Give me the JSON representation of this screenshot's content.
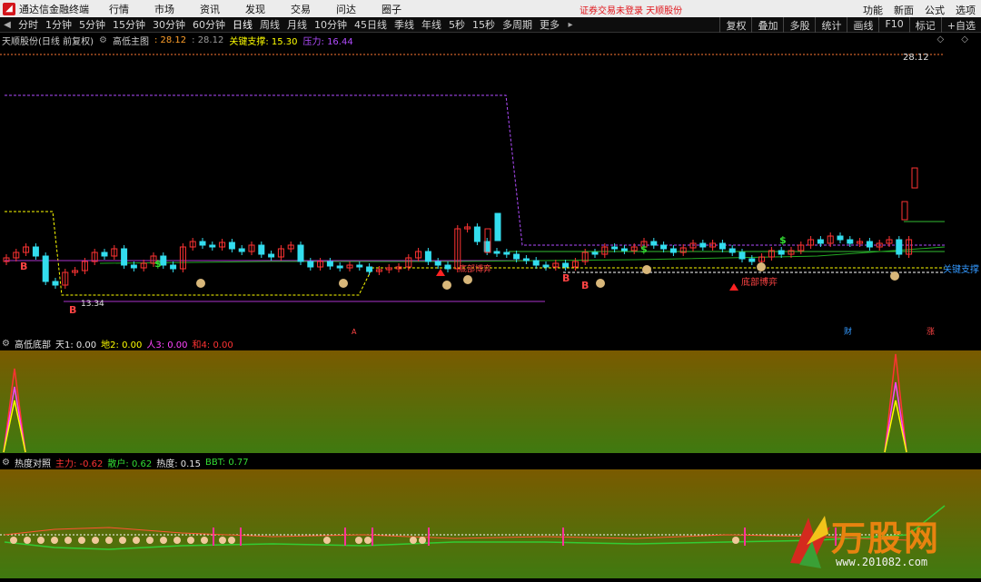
{
  "menubar": {
    "app_title": "通达信金融终端",
    "items": [
      "行情",
      "市场",
      "资讯",
      "发现",
      "交易",
      "问达",
      "圈子"
    ],
    "notice": "证券交易未登录  天顺股份",
    "right_items": [
      "功能",
      "新面",
      "公式",
      "选项"
    ]
  },
  "periodbar": {
    "periods": [
      "分时",
      "1分钟",
      "5分钟",
      "15分钟",
      "30分钟",
      "60分钟",
      "日线",
      "周线",
      "月线",
      "10分钟",
      "45日线",
      "季线",
      "年线",
      "5秒",
      "15秒",
      "多周期",
      "更多"
    ],
    "active": "日线",
    "tools": [
      "复权",
      "叠加",
      "多股",
      "统计",
      "画线",
      "F10",
      "标记",
      "+自选"
    ]
  },
  "infoline": {
    "stock": "天顺股份(日线 前复权)",
    "indicator": "高低主图",
    "value1": ": 28.12",
    "value2": ": 28.12",
    "support_label": "关键支撑: 15.30",
    "pressure_label": "压力: 16.44",
    "icons": "◇ ◇"
  },
  "main_chart": {
    "price_label_top": "28.12",
    "price_label_low": "13.34",
    "support_right_label": "关键支撑",
    "bottom_game_label": "底部博弈",
    "buy_marker": "B",
    "money_marker": "$",
    "bottom_tags": [
      "财",
      "涨"
    ],
    "tiny_marker": "A",
    "colors": {
      "up": "#ff3333",
      "down": "#33ddee",
      "support": "#ffff00",
      "pressure": "#b14cff",
      "avg": "#33bb33"
    }
  },
  "chart_data": [
    {
      "type": "candlestick",
      "title": "天顺股份(日线 前复权) 高低主图",
      "top_price": 28.12,
      "low_price": 13.34,
      "support": 15.3,
      "pressure": 16.44
    },
    {
      "type": "area",
      "title": "高低底部",
      "series": [
        {
          "name": "天1",
          "last": 0.0
        },
        {
          "name": "地2",
          "last": 0.0
        },
        {
          "name": "人3",
          "last": 0.0
        },
        {
          "name": "和4",
          "last": 0.0
        }
      ]
    },
    {
      "type": "line",
      "title": "热度对照",
      "series": [
        {
          "name": "主力",
          "last": -0.62
        },
        {
          "name": "散户",
          "last": 0.62
        },
        {
          "name": "热度",
          "last": 0.15
        },
        {
          "name": "BBT",
          "last": 0.77
        }
      ]
    }
  ],
  "panel2": {
    "title": "高低底部",
    "labels": [
      "天1: 0.00",
      "地2: 0.00",
      "人3: 0.00",
      "和4: 0.00"
    ]
  },
  "panel3": {
    "title": "热度对照",
    "labels": [
      "主力: -0.62",
      "散户: 0.62",
      "热度: 0.15",
      "BBT: 0.77"
    ]
  },
  "watermark": {
    "brand": "万股网",
    "url": "www.201082.com"
  }
}
